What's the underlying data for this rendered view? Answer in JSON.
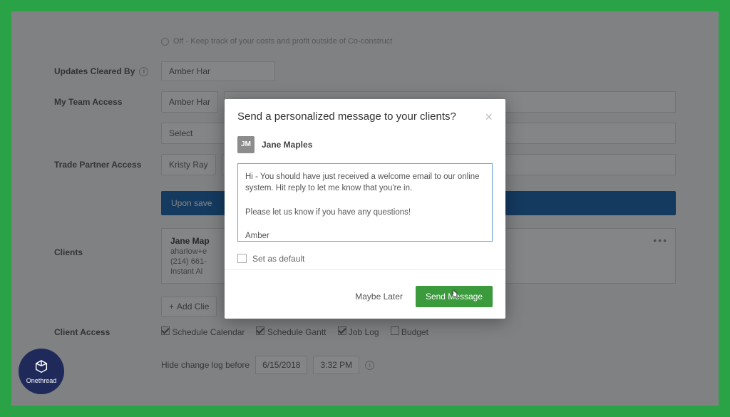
{
  "background": {
    "off_line": "Off - Keep track of your costs and profit outside of Co-construct",
    "updates_cleared_by": {
      "label": "Updates Cleared By",
      "value": "Amber Har"
    },
    "my_team_access": {
      "label": "My Team Access",
      "value": "Amber Har",
      "select_placeholder": "Select"
    },
    "trade_partner_access": {
      "label": "Trade Partner Access",
      "value": "Kristy Ray"
    },
    "clients": {
      "label": "Clients",
      "banner": "Upon save",
      "card": {
        "name": "Jane Map",
        "email": "aharlow+e",
        "phone": "(214) 661-",
        "instant": "Instant Al"
      },
      "add_button": "Add Clie"
    },
    "client_access": {
      "label": "Client Access",
      "options": [
        {
          "label": "Schedule Calendar",
          "checked": true
        },
        {
          "label": "Schedule Gantt",
          "checked": true
        },
        {
          "label": "Job Log",
          "checked": true
        },
        {
          "label": "Budget",
          "checked": false
        }
      ]
    },
    "hide_log": {
      "label": "Hide change log before",
      "date": "6/15/2018",
      "time": "3:32 PM"
    }
  },
  "modal": {
    "title": "Send a personalized message to your clients?",
    "recipient": {
      "initials": "JM",
      "name": "Jane Maples"
    },
    "message": "Hi - You should have just received a welcome email to our online system. Hit reply to let me know that you're in.\n\nPlease let us know if you have any questions!\n\nAmber",
    "set_default_label": "Set as default",
    "later_label": "Maybe Later",
    "send_label": "Send Message"
  },
  "branding": {
    "name": "Onethread"
  }
}
